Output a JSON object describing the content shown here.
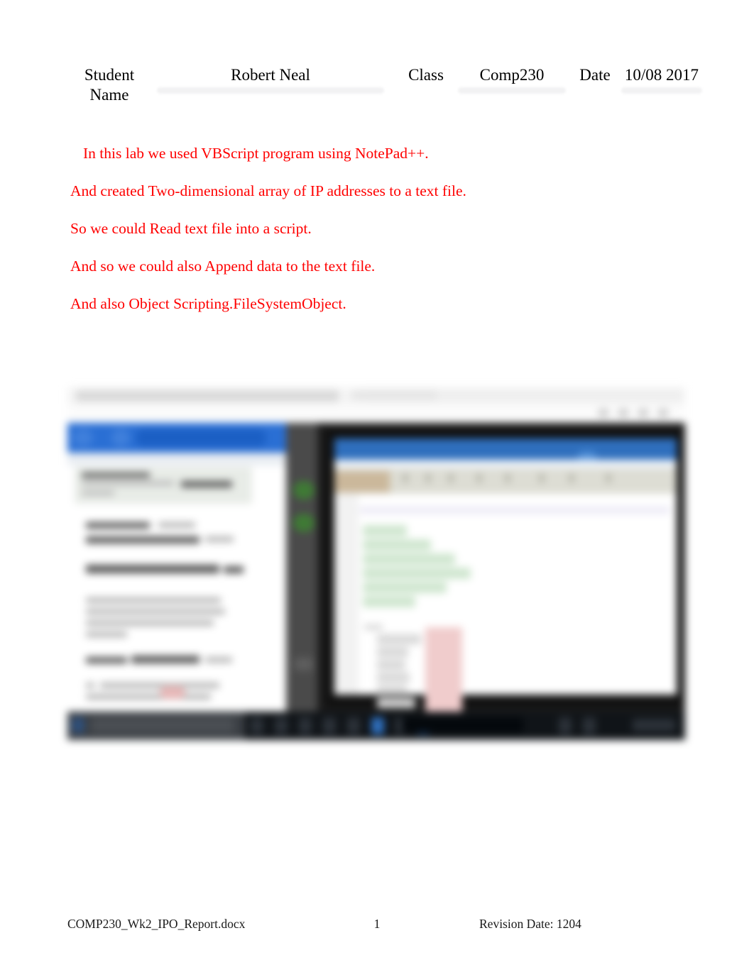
{
  "document": {
    "header": {
      "student_name_label": "Student Name",
      "student_name_value": "Robert Neal",
      "class_label": "Class",
      "class_value": "Comp230",
      "date_label": "Date",
      "date_value": "10/08 2017"
    },
    "body_paragraphs": [
      "In this lab we used VBScript program using NotePad++.",
      "And created Two-dimensional array of IP addresses to a text file.",
      "So we could Read text file into a script.",
      "And so we could also Append data to the text file.",
      "And also Object Scripting.FileSystemObject."
    ],
    "body_text_color": "#ff0000",
    "embedded_screenshot": {
      "caption": "",
      "description": "blurred desktop screenshot showing a document window on the left, a dark vertical panel with two green icons, and an editor window on the right over a dark taskbar"
    },
    "footer": {
      "file_name": "COMP230_Wk2_IPO_Report.docx",
      "page_number": "1",
      "revision": "Revision Date: 1204"
    }
  }
}
